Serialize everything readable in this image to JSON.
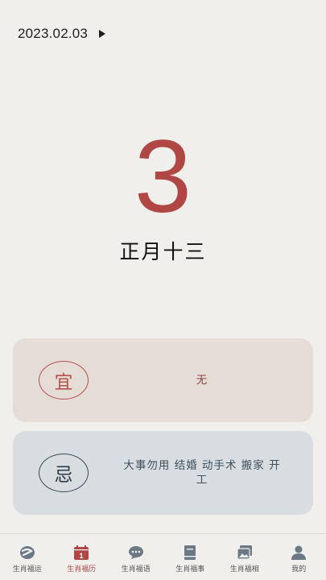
{
  "header": {
    "date": "2023.02.03"
  },
  "main": {
    "day": "3",
    "lunar": "正月十三"
  },
  "yi": {
    "badge": "宜",
    "text": "无"
  },
  "ji": {
    "badge": "忌",
    "text": "大事勿用  结婚  动手术  搬家  开工"
  },
  "tabs": [
    {
      "label": "生肖福运",
      "icon": "fortune-icon"
    },
    {
      "label": "生肖福历",
      "icon": "calendar-icon",
      "calendar_day": "1",
      "active": true
    },
    {
      "label": "生肖福语",
      "icon": "chat-icon"
    },
    {
      "label": "生肖福事",
      "icon": "book-icon"
    },
    {
      "label": "生肖福相",
      "icon": "gallery-icon"
    },
    {
      "label": "我的",
      "icon": "profile-icon"
    }
  ],
  "colors": {
    "accent": "#b04745",
    "yi_bg": "#e6dcd6",
    "ji_bg": "#d8dde2",
    "background": "#f1efec"
  }
}
